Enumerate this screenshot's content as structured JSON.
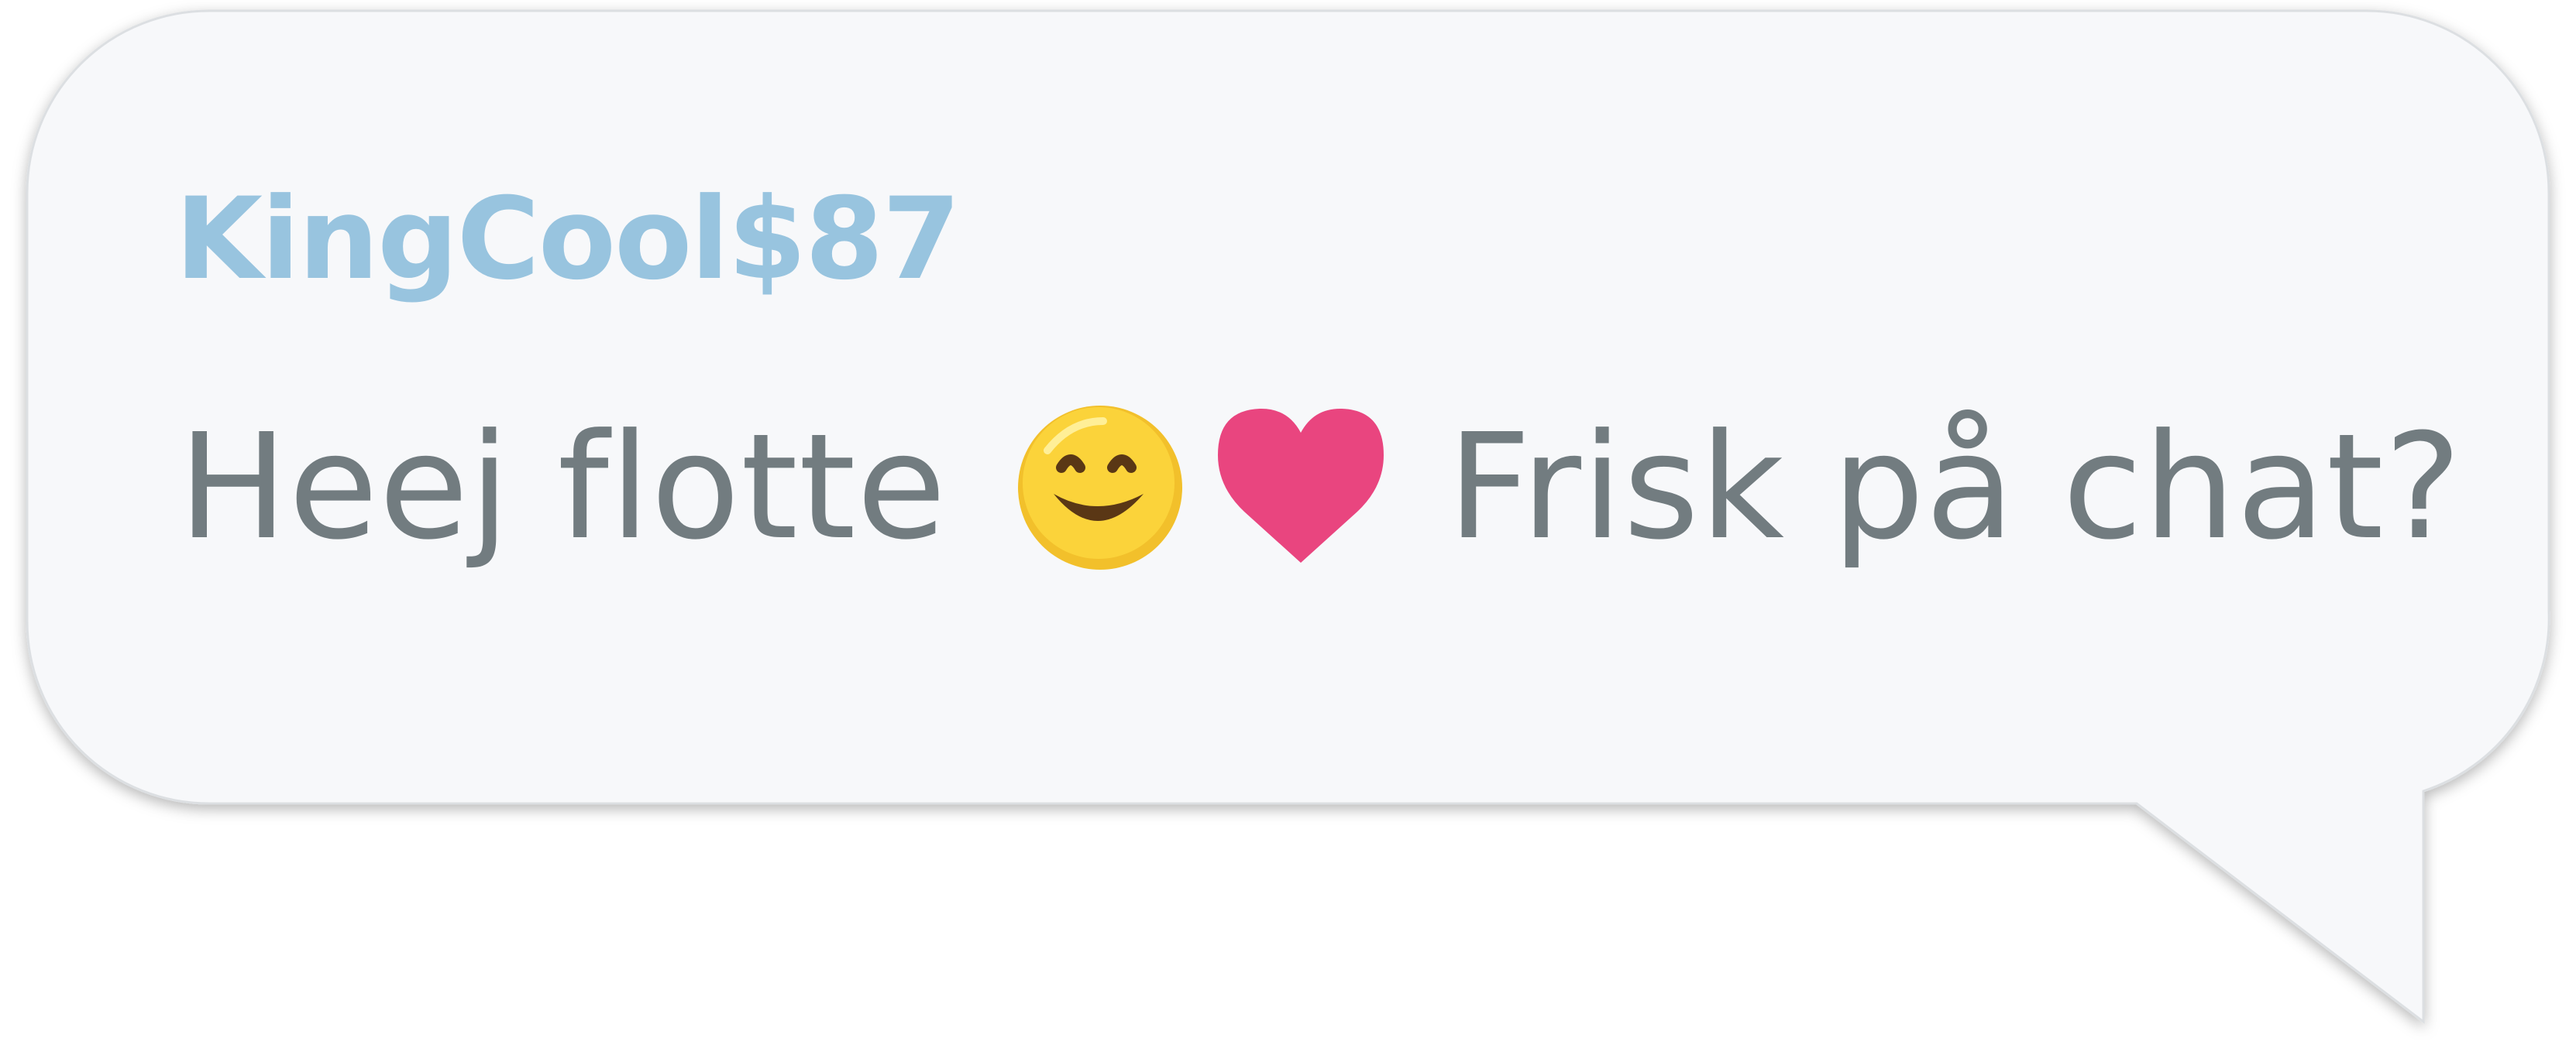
{
  "message": {
    "username": "KingCool$87",
    "text_before": "Heej flotte",
    "text_after": "Frisk på chat?",
    "emojis": [
      "smiling-face-icon",
      "heart-icon"
    ]
  },
  "colors": {
    "username": "#98c4df",
    "message_text": "#727c80",
    "bubble_fill": "#f7f8fa",
    "heart": "#e9457f",
    "emoji_face": "#fbd33a"
  }
}
